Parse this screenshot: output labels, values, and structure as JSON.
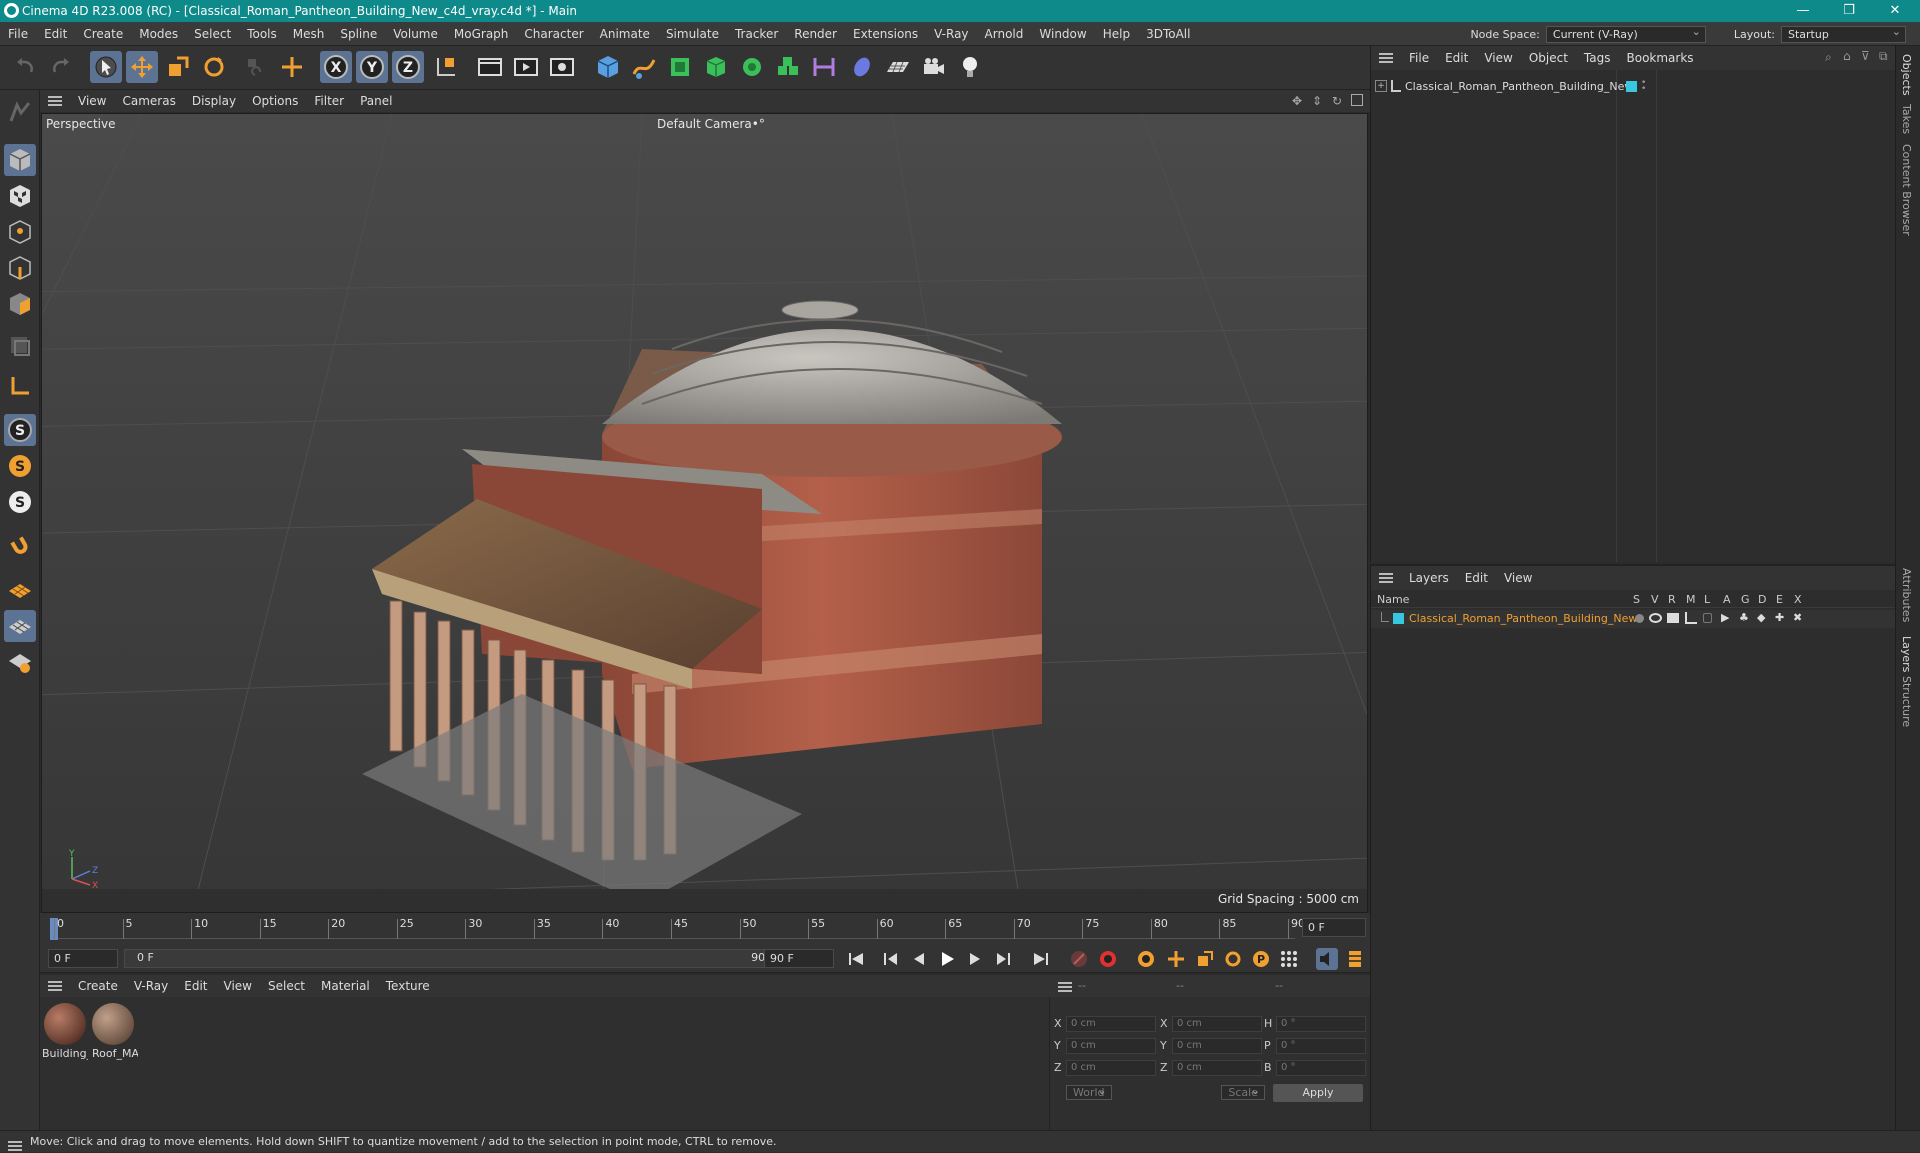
{
  "window": {
    "title": "Cinema 4D R23.008 (RC) - [Classical_Roman_Pantheon_Building_New_c4d_vray.c4d *] - Main",
    "minimize": "—",
    "restore": "❐",
    "close": "✕"
  },
  "menubar": {
    "items": [
      "File",
      "Edit",
      "Create",
      "Modes",
      "Select",
      "Tools",
      "Mesh",
      "Spline",
      "Volume",
      "MoGraph",
      "Character",
      "Animate",
      "Simulate",
      "Tracker",
      "Render",
      "Extensions",
      "V-Ray",
      "Arnold",
      "Window",
      "Help",
      "3DToAll"
    ],
    "node_space_label": "Node Space:",
    "node_space_value": "Current (V-Ray)",
    "layout_label": "Layout:",
    "layout_value": "Startup"
  },
  "toolbar": {
    "axis_x": "X",
    "axis_y": "Y",
    "axis_z": "Z"
  },
  "lefttools": {
    "s1": "S",
    "s2": "S",
    "s3": "S"
  },
  "viewport_menu": {
    "items": [
      "View",
      "Cameras",
      "Display",
      "Options",
      "Filter",
      "Panel"
    ]
  },
  "viewport": {
    "projection": "Perspective",
    "camera": "Default Camera",
    "camera_marker": "•°",
    "grid_spacing": "Grid Spacing : 5000 cm",
    "axis_x": "X",
    "axis_y": "Y",
    "axis_z": "Z"
  },
  "timeline": {
    "ticks": [
      "0",
      "5",
      "10",
      "15",
      "20",
      "25",
      "30",
      "35",
      "40",
      "45",
      "50",
      "55",
      "60",
      "65",
      "70",
      "75",
      "80",
      "85",
      "90"
    ],
    "current_frame": "0 F"
  },
  "transport": {
    "start_frame": "0 F",
    "range_start": "0 F",
    "range_end": "90 F",
    "end_frame": "90 F"
  },
  "materials": {
    "menu": [
      "Create",
      "V-Ray",
      "Edit",
      "View",
      "Select",
      "Material",
      "Texture"
    ],
    "items": [
      {
        "label": "Building_",
        "color": "#6a3a2c"
      },
      {
        "label": "Roof_MA",
        "color": "#7a5a45"
      }
    ]
  },
  "attributes": {
    "header": [
      "--",
      "--",
      "--"
    ],
    "rows": [
      {
        "l1": "X",
        "v1": "0 cm",
        "l2": "X",
        "v2": "0 cm",
        "l3": "H",
        "v3": "0 °"
      },
      {
        "l1": "Y",
        "v1": "0 cm",
        "l2": "Y",
        "v2": "0 cm",
        "l3": "P",
        "v3": "0 °"
      },
      {
        "l1": "Z",
        "v1": "0 cm",
        "l2": "Z",
        "v2": "0 cm",
        "l3": "B",
        "v3": "0 °"
      }
    ],
    "coord_system": "World",
    "mode": "Scale",
    "apply": "Apply"
  },
  "objects": {
    "menu": [
      "File",
      "Edit",
      "View",
      "Object",
      "Tags",
      "Bookmarks"
    ],
    "items": [
      {
        "name": "Classical_Roman_Pantheon_Building_New",
        "color": "#37c8e0"
      }
    ]
  },
  "layers": {
    "menu": [
      "Layers",
      "Edit",
      "View"
    ],
    "columns": [
      "Name",
      "S",
      "V",
      "R",
      "M",
      "L",
      "A",
      "G",
      "D",
      "E",
      "X"
    ],
    "items": [
      {
        "name": "Classical_Roman_Pantheon_Building_New",
        "color": "#37c8e0"
      }
    ]
  },
  "right_tabs": [
    "Objects",
    "Takes",
    "Content Browser",
    "Attributes",
    "Layers",
    "Structure"
  ],
  "status": "Move: Click and drag to move elements. Hold down SHIFT to quantize movement / add to the selection in point mode, CTRL to remove.",
  "colors": {
    "titlebar": "#0f8a8a",
    "active_tool": "#5d7393",
    "accent_orange": "#f0a030",
    "layer_text": "#f0a030"
  }
}
